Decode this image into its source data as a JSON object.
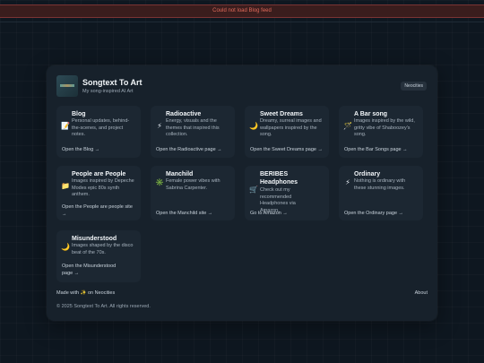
{
  "banner": {
    "error_text": "Could not load Blog feed"
  },
  "header": {
    "title": "Songtext To Art",
    "subtitle": "My song-inspired AI Art",
    "neocities_label": "Neocities"
  },
  "tiles": [
    {
      "icon": "memo-icon",
      "glyph": "📝",
      "title": "Blog",
      "desc": "Personal updates, behind-the-scenes, and project notes.",
      "link": "Open the Blog →"
    },
    {
      "icon": "lightning-icon",
      "glyph": "⚡",
      "title": "Radioactive",
      "desc": "Energy, visuals and the themes that inspired this collection.",
      "link": "Open the Radioactive page →"
    },
    {
      "icon": "crescent-moon-icon",
      "glyph": "🌙",
      "title": "Sweet Dreams",
      "desc": "Dreamy, surreal images and wallpapers inspired by the song.",
      "link": "Open the Sweet Dreams page →"
    },
    {
      "icon": "magic-wand-icon",
      "glyph": "🪄",
      "title": "A Bar song",
      "desc": "Images inspired by the wild, gritty vibe of Shaboozey's song.",
      "link": "Open the Bar Songs page →"
    },
    {
      "icon": "folder-icon",
      "glyph": "📁",
      "title": "People are People",
      "desc": "Images inspired by Depeche Modes epic 80s synth anthem.",
      "link": "Open the People are people site →"
    },
    {
      "icon": "sparkle-icon",
      "glyph": "✳️",
      "title": "Manchild",
      "desc": "Female power vibes with Sabrina Carpenter.",
      "link": "Open the Manchild site →"
    },
    {
      "icon": "shopping-cart-icon",
      "glyph": "🛒",
      "title": "BERIBES Headphones",
      "desc": "Check out my recommended Headphones via Amazon.",
      "link": "Go to Amazon →"
    },
    {
      "icon": "lightning-icon",
      "glyph": "⚡",
      "title": "Ordinary",
      "desc": "Nothing is ordinary with these stunning images.",
      "link": "Open the Ordinary page →"
    },
    {
      "icon": "crescent-moon-icon",
      "glyph": "🌙",
      "title": "Misunderstood",
      "desc": "Images shaped by the disco beat of the 70s.",
      "link": "Open the Misunderstood page →"
    }
  ],
  "footer": {
    "made_with": "Made with ✨ on Neocities",
    "about": "About",
    "copyright": "© 2025 Songtext To Art. All rights reserved."
  },
  "colors": {
    "background": "#0e1720",
    "card": "#17212b",
    "tile": "#1c2732",
    "error_text": "#e06a5a",
    "error_bg": "#3a1d1d"
  }
}
